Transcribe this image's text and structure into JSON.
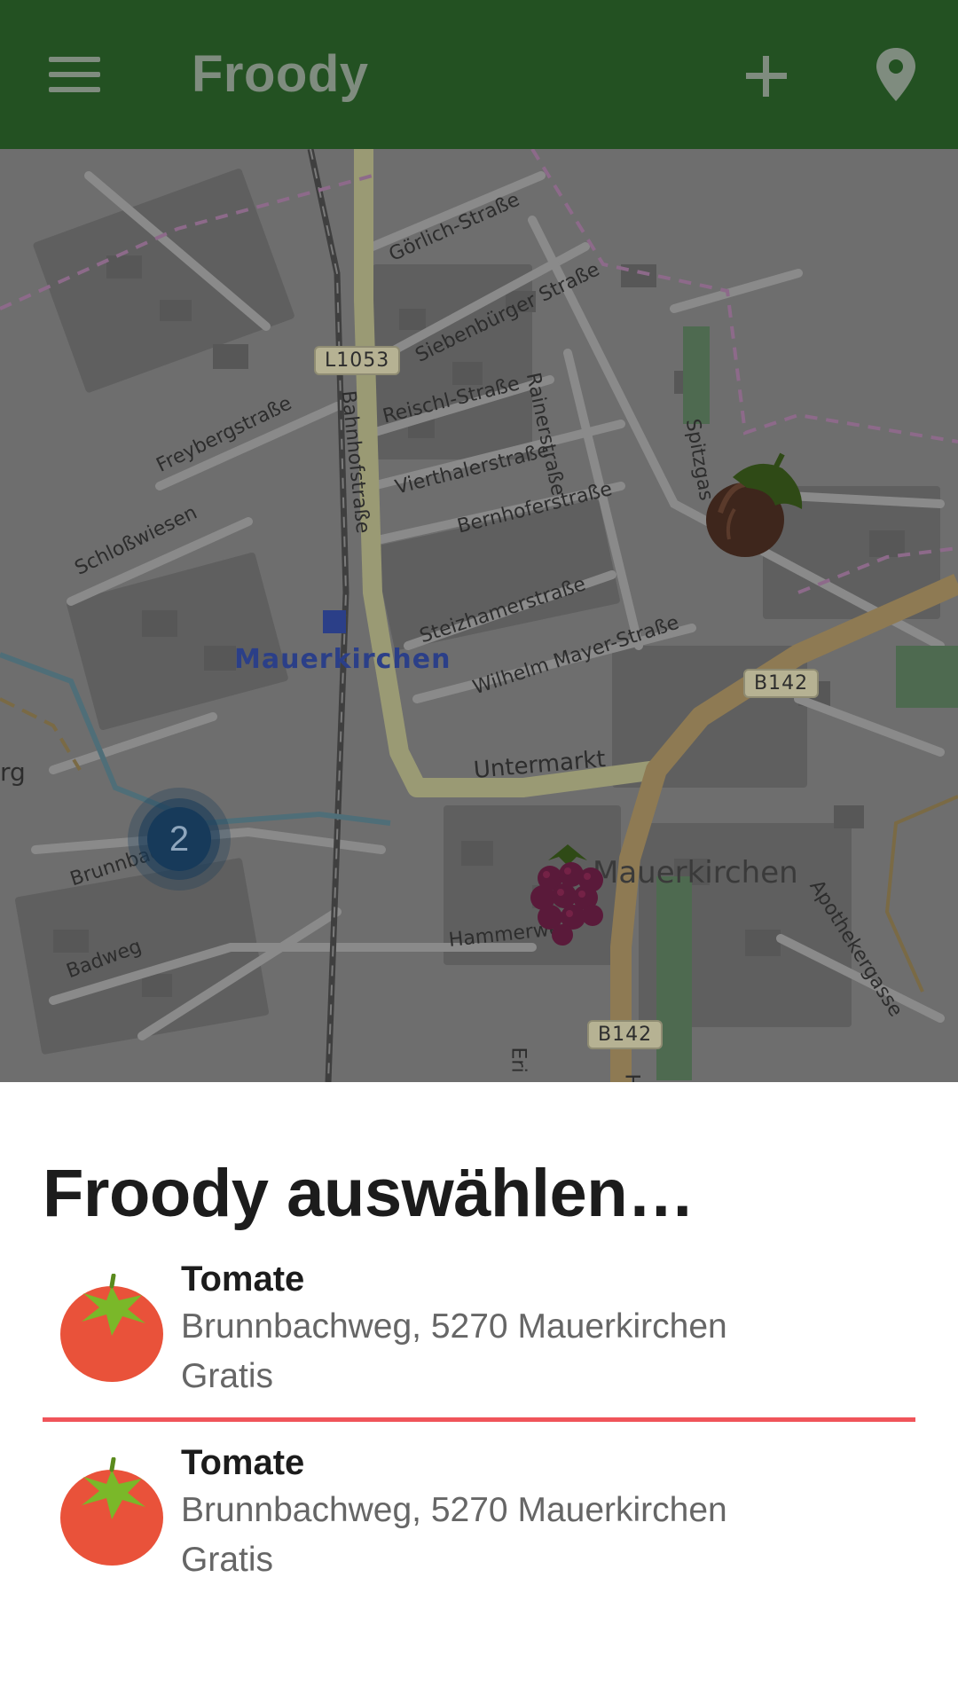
{
  "app_bar": {
    "title": "Froody",
    "menu_icon": "hamburger-menu-icon",
    "add_icon": "plus-icon",
    "location_icon": "location-pin-icon",
    "background_color": "#235122"
  },
  "map": {
    "streets": {
      "goerlich": "Görlich-Straße",
      "siebenbuerger": "Siebenbürger Straße",
      "reischl": "Reischl-Straße",
      "rainer": "Rainerstraße",
      "vierthaler": "Vierthalerstraße",
      "bernhofer": "Bernhoferstraße",
      "spitzgasse": "Spitzgas",
      "freyberg": "Freybergstraße",
      "schlosswiesen": "Schloßwiesen",
      "bahnhof": "Bahnhofstraße",
      "steizhamer": "Steizhamerstraße",
      "wilhelm_mayer": "Wilhelm Mayer-Straße",
      "untermarkt": "Untermarkt",
      "brunnbach": "Brunnbac",
      "hammerweg": "Hammerweg",
      "badweg": "Badweg",
      "apotheker": "Apothekergasse",
      "rg": "rg",
      "eri": "Eri",
      "h": "H"
    },
    "road_shields": {
      "l1053": "L1053",
      "b142_upper": "B142",
      "b142_lower": "B142"
    },
    "town_label": "Mauerkirchen",
    "area_label": "Mauerkirchen",
    "cluster_count": "2",
    "markers": [
      "hazelnut-marker",
      "raspberry-marker"
    ]
  },
  "sheet": {
    "title": "Froody auswählen…",
    "items": [
      {
        "name": "Tomate",
        "address": "Brunnbachweg, 5270 Mauerkirchen",
        "price": "Gratis",
        "icon": "tomato-icon"
      },
      {
        "name": "Tomate",
        "address": "Brunnbachweg, 5270 Mauerkirchen",
        "price": "Gratis",
        "icon": "tomato-icon"
      }
    ],
    "selected_divider_color": "#f0545a"
  }
}
